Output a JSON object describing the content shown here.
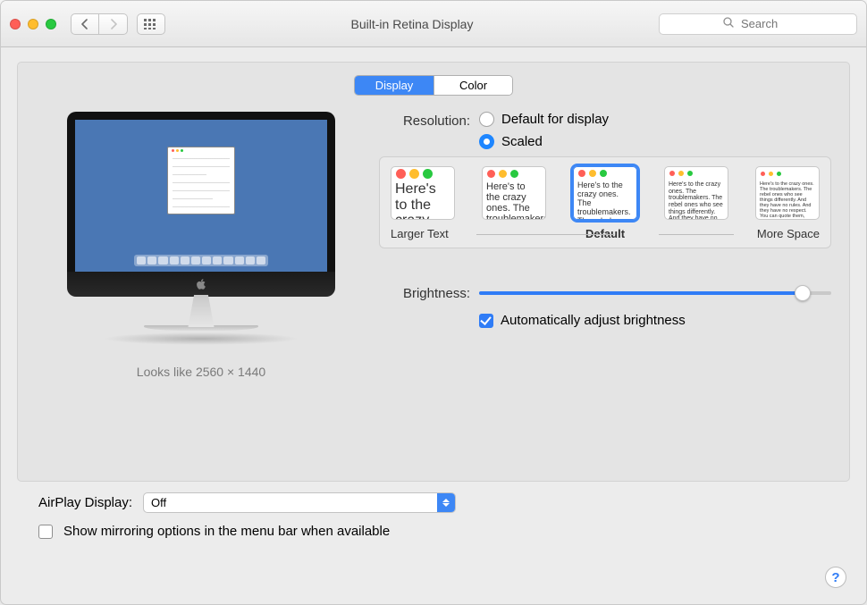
{
  "window": {
    "title": "Built-in Retina Display"
  },
  "search": {
    "placeholder": "Search"
  },
  "tabs": {
    "display": "Display",
    "color": "Color",
    "active": "display"
  },
  "preview": {
    "looks_like": "Looks like 2560 × 1440"
  },
  "resolution": {
    "label": "Resolution:",
    "option_default": "Default for display",
    "option_scaled": "Scaled",
    "selected": "scaled",
    "scale_labels": {
      "left": "Larger Text",
      "center": "Default",
      "right": "More Space"
    },
    "thumbs_sample": "Here's to the crazy ones. The troublemakers. The rebel ones who see things differently. And they have no rules. And they have no respect. You can quote them, disagree with them. About the only thing. Because they change things.",
    "selected_index": 2
  },
  "brightness": {
    "label": "Brightness:",
    "value_percent": 92,
    "auto_label": "Automatically adjust brightness",
    "auto_checked": true
  },
  "airplay": {
    "label": "AirPlay Display:",
    "value": "Off"
  },
  "mirroring": {
    "label": "Show mirroring options in the menu bar when available",
    "checked": false
  }
}
